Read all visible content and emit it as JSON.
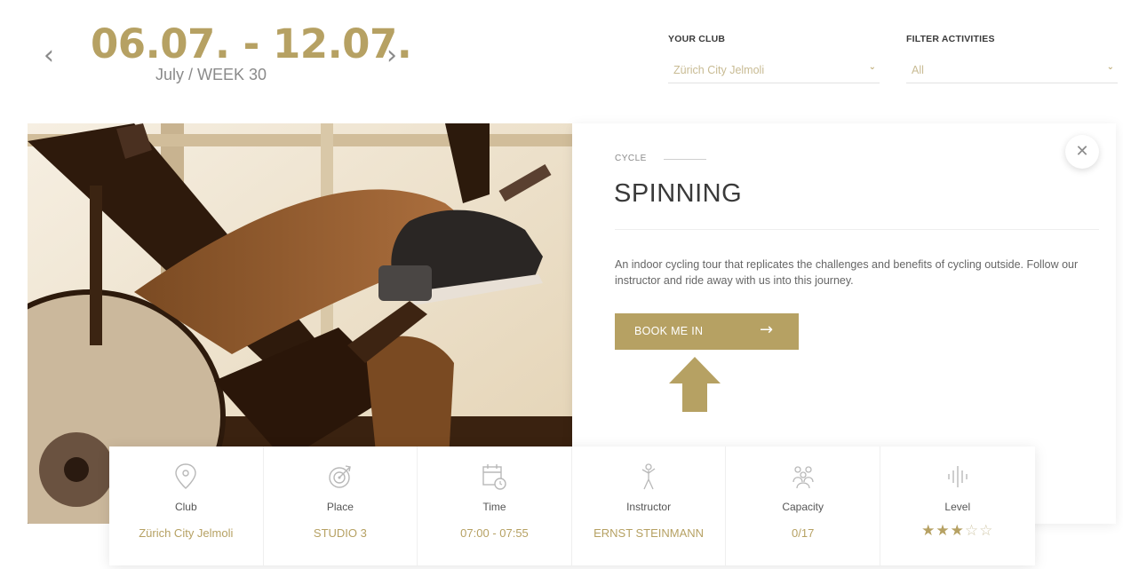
{
  "week": {
    "range": "06.07. - 12.07.",
    "subtitle": "July / WEEK 30",
    "prev_icon": "chevron-left-icon",
    "next_icon": "chevron-right-icon"
  },
  "filters": {
    "club": {
      "label": "YOUR CLUB",
      "value": "Zürich City Jelmoli"
    },
    "activities": {
      "label": "FILTER ACTIVITIES",
      "value": "All"
    }
  },
  "activity": {
    "category": "CYCLE",
    "title": "SPINNING",
    "description": "An indoor cycling tour that replicates the challenges and benefits of cycling outside. Follow our instructor and ride away with us into this journey.",
    "book_label": "BOOK ME IN",
    "close_icon": "close-icon"
  },
  "info": {
    "club": {
      "label": "Club",
      "value": "Zürich City Jelmoli",
      "icon": "location-pin-icon"
    },
    "place": {
      "label": "Place",
      "value": "STUDIO 3",
      "icon": "target-icon"
    },
    "time": {
      "label": "Time",
      "value": "07:00 - 07:55",
      "icon": "calendar-clock-icon"
    },
    "instructor": {
      "label": "Instructor",
      "value": "ERNST STEINMANN",
      "icon": "person-icon"
    },
    "capacity": {
      "label": "Capacity",
      "value": "0/17",
      "icon": "group-icon"
    },
    "level": {
      "label": "Level",
      "rating": 3,
      "max": 5,
      "icon": "sound-level-icon"
    }
  },
  "colors": {
    "accent": "#b6a163",
    "text_dark": "#3a3a3a",
    "text_muted": "#8a8a8a"
  }
}
